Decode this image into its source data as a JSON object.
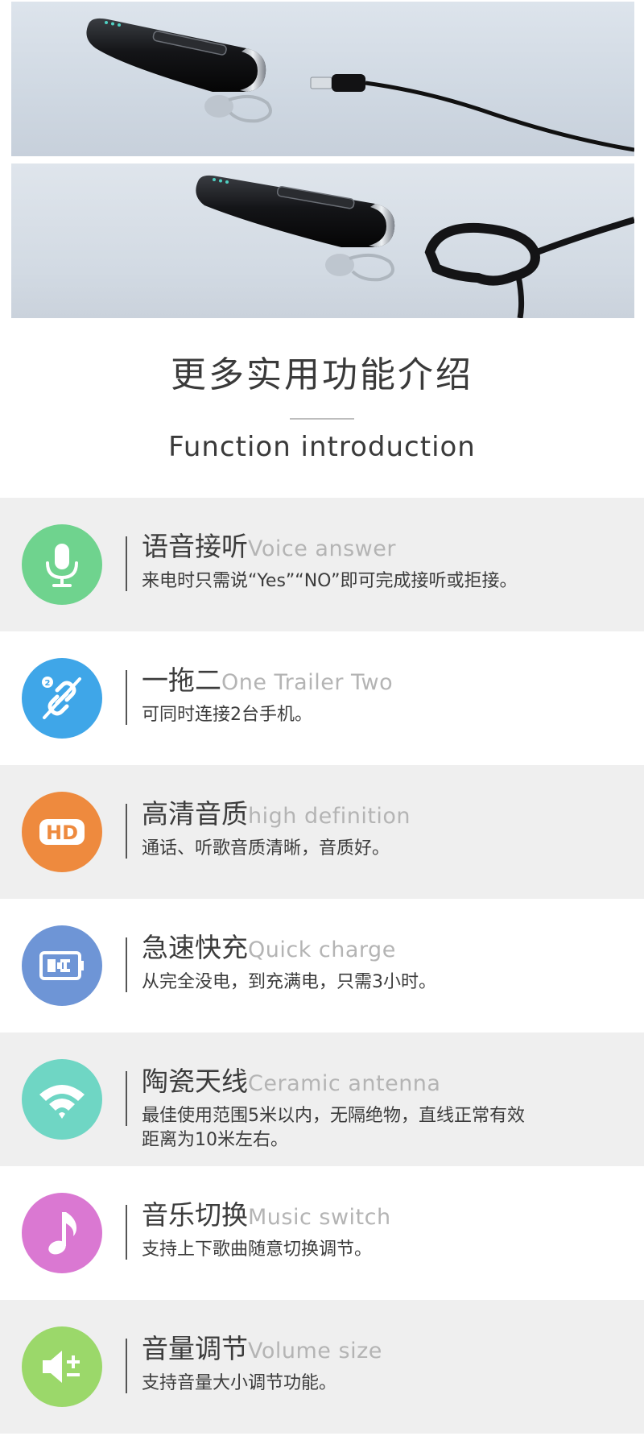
{
  "heading": {
    "title_cn": "更多实用功能介绍",
    "title_en": "Function introduction"
  },
  "colors": {
    "voice": "#6fd38e",
    "trailer": "#3fa6e8",
    "hd": "#ee8a3e",
    "charge": "#6e95d6",
    "antenna": "#6fd6c4",
    "music": "#da78d2",
    "volume": "#9bd86a",
    "alt_bg": "#efefef"
  },
  "features": [
    {
      "icon": "microphone-icon",
      "title_cn": "语音接听",
      "title_en": "Voice answer",
      "desc": "来电时只需说“Yes”“NO”即可完成接听或拒接。"
    },
    {
      "icon": "link-two-icon",
      "title_cn": "一拖二",
      "title_en": "One Trailer Two",
      "desc": "可同时连接2台手机。"
    },
    {
      "icon": "hd-icon",
      "title_cn": "高清音质",
      "title_en": "high definition",
      "desc": "通话、听歌音质清晰，音质好。"
    },
    {
      "icon": "battery-charge-icon",
      "title_cn": "急速快充",
      "title_en": "Quick charge",
      "desc": "从完全没电，到充满电，只需3小时。"
    },
    {
      "icon": "wifi-icon",
      "title_cn": "陶瓷天线",
      "title_en": "Ceramic antenna",
      "desc": "最佳使用范围5米以内，无隔绝物，直线正常有效\n距离为10米左右。"
    },
    {
      "icon": "music-note-icon",
      "title_cn": "音乐切换",
      "title_en": "Music switch",
      "desc": "支持上下歌曲随意切换调节。"
    },
    {
      "icon": "volume-icon",
      "title_cn": "音量调节",
      "title_en": "Volume size",
      "desc": "支持音量大小调节功能。"
    }
  ]
}
